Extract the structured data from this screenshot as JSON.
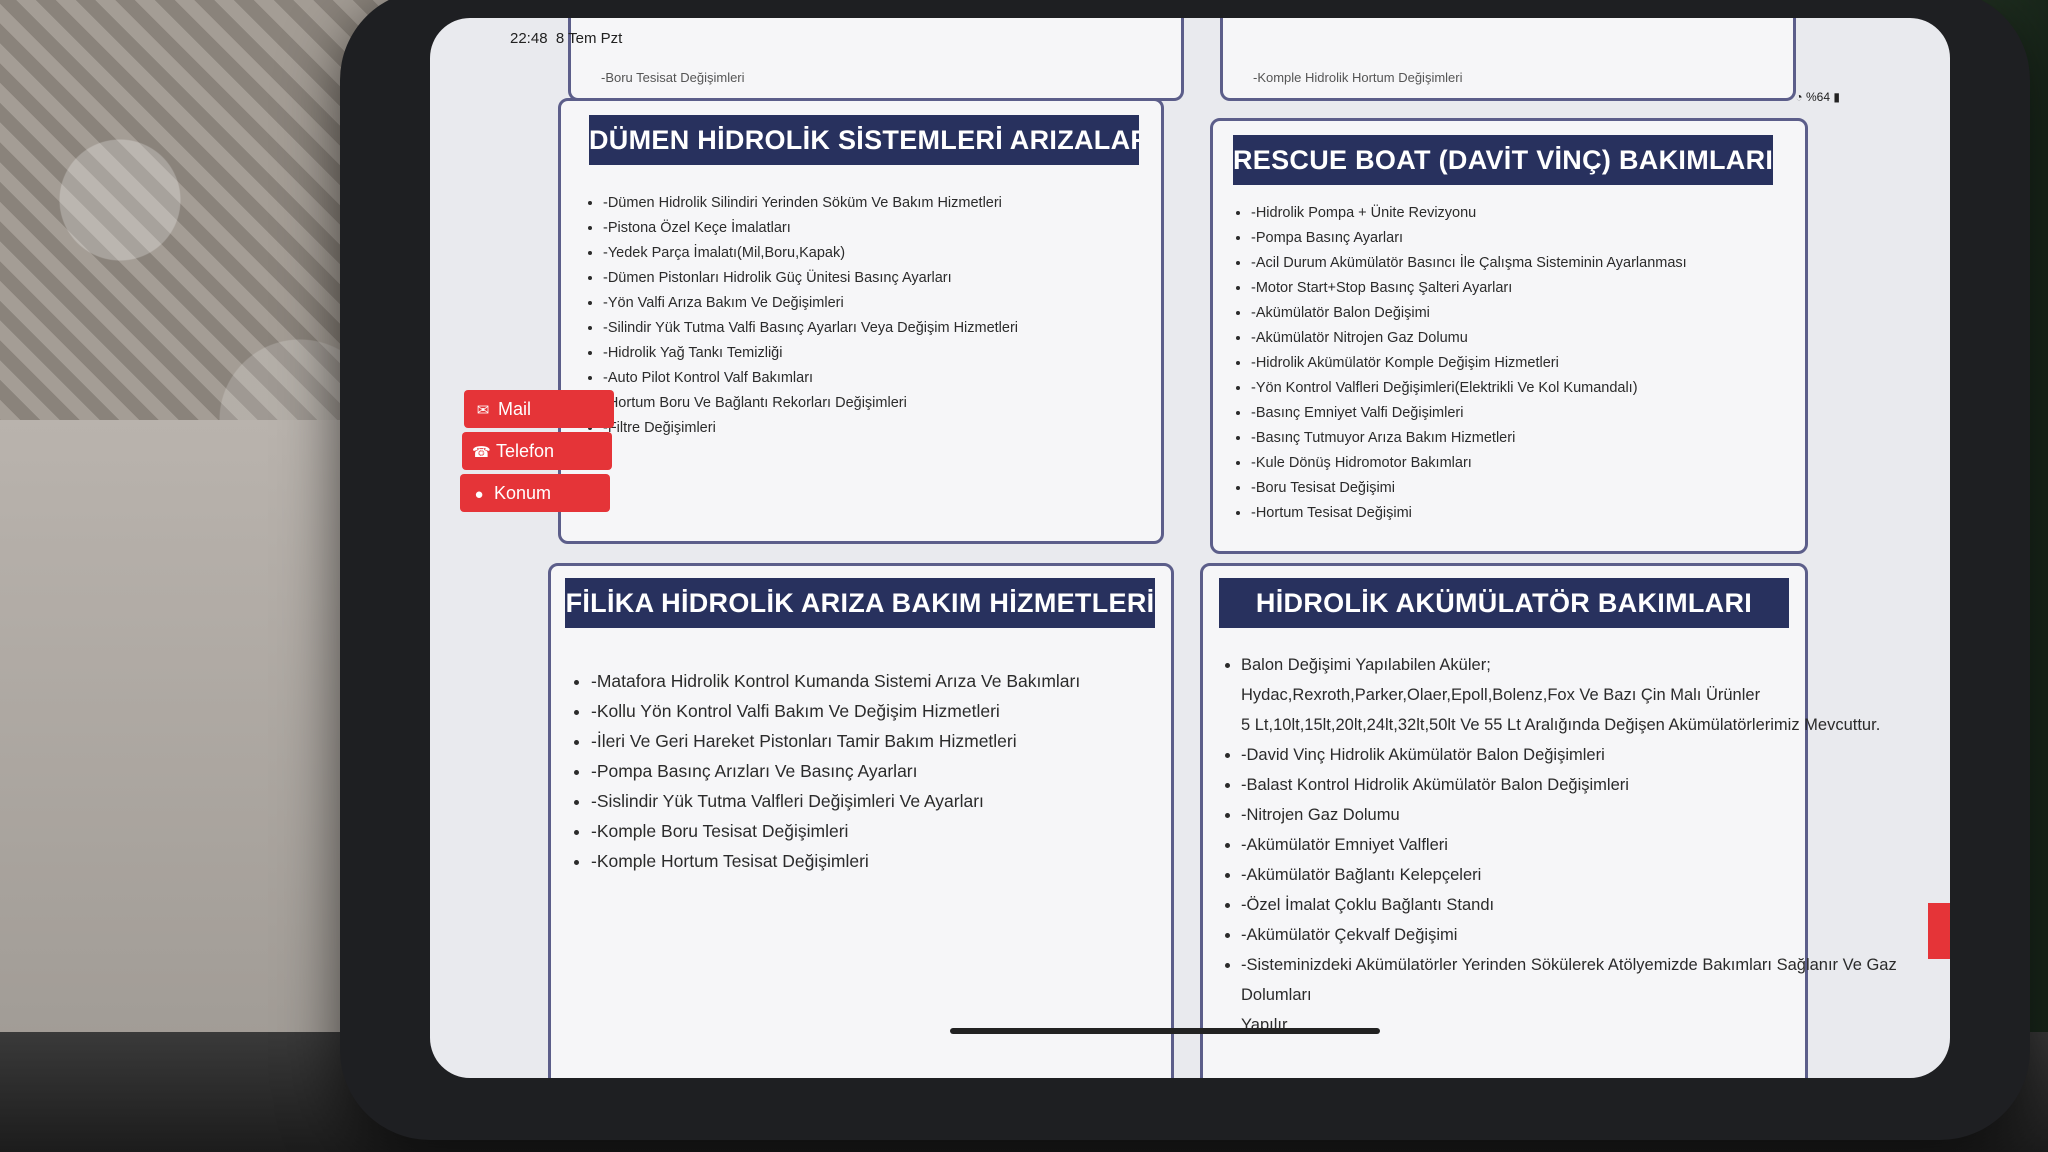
{
  "status_bar": {
    "time": "22:48",
    "date": "8 Tem Pzt",
    "battery": "%64"
  },
  "top_partial": {
    "left_item": "-Boru Tesisat Değişimleri",
    "right_item": "-Komple Hidrolik Hortum Değişimleri"
  },
  "cards": {
    "dumen": {
      "title": "DÜMEN HİDROLİK SİSTEMLERİ ARIZALARI",
      "items": [
        "-Dümen Hidrolik Silindiri Yerinden Söküm Ve Bakım Hizmetleri",
        "-Pistona Özel Keçe İmalatları",
        "-Yedek Parça İmalatı(Mil,Boru,Kapak)",
        "-Dümen Pistonları Hidrolik Güç Ünitesi Basınç Ayarları",
        "-Yön Valfi Arıza Bakım Ve Değişimleri",
        "-Silindir Yük Tutma Valfi Basınç Ayarları Veya Değişim Hizmetleri",
        "-Hidrolik Yağ Tankı Temizliği",
        "-Auto Pilot Kontrol Valf Bakımları",
        "-Hortum Boru Ve Bağlantı Rekorları Değişimleri",
        "-Filtre Değişimleri"
      ]
    },
    "rescue": {
      "title": "RESCUE BOAT (DAVİT VİNÇ) BAKIMLARI",
      "items": [
        "-Hidrolik Pompa + Ünite Revizyonu",
        "-Pompa Basınç Ayarları",
        "-Acil Durum Akümülatör Basıncı İle Çalışma Sisteminin Ayarlanması",
        "-Motor Start+Stop Basınç Şalteri Ayarları",
        "-Akümülatör Balon Değişimi",
        "-Akümülatör Nitrojen Gaz Dolumu",
        "-Hidrolik Akümülatör Komple Değişim Hizmetleri",
        "-Yön Kontrol Valfleri Değişimleri(Elektrikli Ve Kol Kumandalı)",
        "-Basınç Emniyet Valfi Değişimleri",
        "-Basınç Tutmuyor Arıza Bakım Hizmetleri",
        "-Kule Dönüş Hidromotor Bakımları",
        "-Boru Tesisat Değişimi",
        "-Hortum Tesisat Değişimi"
      ]
    },
    "filika": {
      "title": "FİLİKA HİDROLİK ARIZA BAKIM HİZMETLERİ",
      "items": [
        "-Matafora Hidrolik Kontrol Kumanda Sistemi Arıza Ve Bakımları",
        "-Kollu Yön Kontrol Valfi Bakım Ve Değişim Hizmetleri",
        "-İleri Ve Geri Hareket Pistonları Tamir Bakım Hizmetleri",
        "-Pompa Basınç Arızları Ve Basınç Ayarları",
        "-Sislindir Yük Tutma Valfleri Değişimleri Ve Ayarları",
        "-Komple Boru Tesisat Değişimleri",
        "-Komple Hortum Tesisat Değişimleri"
      ]
    },
    "akumulator": {
      "title": "HİDROLİK AKÜMÜLATÖR BAKIMLARI",
      "intro": "Balon Değişimi Yapılabilen Aküler;",
      "brands": "Hydac,Rexroth,Parker,Olaer,Epoll,Bolenz,Fox Ve Bazı Çin Malı Ürünler",
      "sizes": "5 Lt,10lt,15lt,20lt,24lt,32lt,50lt Ve 55 Lt Aralığında Değişen Akümülatörlerimiz Mevcuttur.",
      "items": [
        "-David Vinç Hidrolik Akümülatör Balon Değişimleri",
        "-Balast Kontrol Hidrolik Akümülatör Balon Değişimleri",
        "-Nitrojen Gaz Dolumu",
        "-Akümülatör Emniyet Valfleri",
        "-Akümülatör Bağlantı Kelepçeleri",
        "-Özel İmalat Çoklu Bağlantı Standı",
        "-Akümülatör Çekvalf Değişimi",
        "-Sisteminizdeki Akümülatörler Yerinden Sökülerek Atölyemizde Bakımları Sağlanır Ve Gaz"
      ],
      "cont1": "Dolumları",
      "cont2": "Yapılır."
    }
  },
  "contact_buttons": {
    "mail": "Mail",
    "phone": "Telefon",
    "location": "Konum"
  },
  "icons": {
    "mail": "envelope-icon",
    "phone": "phone-icon",
    "location": "map-pin-icon",
    "scroll": "chevron-up-icon"
  },
  "colors": {
    "header_bg": "#28315e",
    "accent_red": "#e53438",
    "card_border": "#5c5e8a"
  }
}
